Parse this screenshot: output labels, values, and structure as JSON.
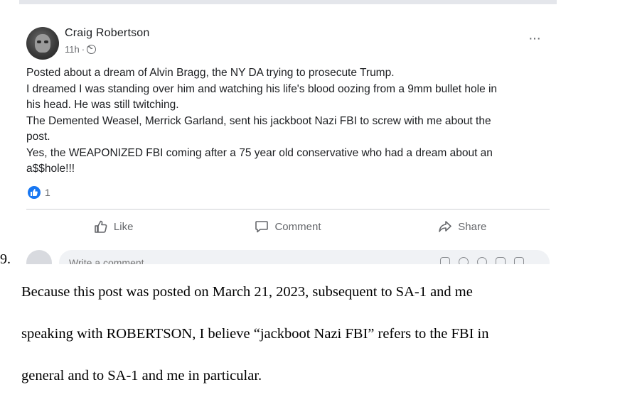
{
  "post": {
    "author": "Craig Robertson",
    "time": "11h",
    "separator": "·",
    "more_label": "···",
    "lines": [
      "Posted about a dream of Alvin Bragg, the NY DA trying to prosecute Trump.",
      "I dreamed I was standing over him and watching his life's blood oozing from a 9mm bullet hole in",
      "his head. He was still twitching.",
      "The Demented Weasel, Merrick Garland, sent his jackboot Nazi FBI to screw with me about the",
      "post.",
      "Yes, the WEAPONIZED FBI coming after a 75 year old conservative who had a dream about an",
      "a$$hole!!!"
    ],
    "reaction_count": "1",
    "reaction_icon": "thumbs-up-icon",
    "actions": {
      "like": "Like",
      "comment": "Comment",
      "share": "Share"
    },
    "comment_placeholder": "Write a comment...",
    "accent_color": "#1877f2"
  },
  "document": {
    "paragraph_number": "9.",
    "lines": [
      "Because this post was posted on March 21, 2023, subsequent to SA-1 and me",
      "speaking with ROBERTSON, I believe “jackboot Nazi FBI” refers to the FBI in",
      "general and to SA-1 and me in particular."
    ]
  }
}
